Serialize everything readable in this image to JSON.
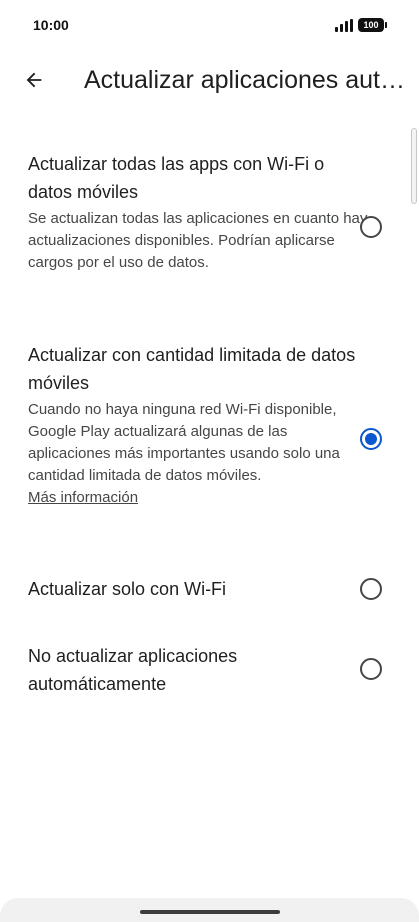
{
  "status_bar": {
    "time": "10:00",
    "battery": "100",
    "icons": [
      "signal-icon",
      "battery-icon"
    ]
  },
  "app_bar": {
    "title": "Actualizar aplicaciones automáticamente",
    "back_icon": "arrow-back-icon"
  },
  "options": [
    {
      "title": "Actualizar todas las apps con Wi-Fi o datos móviles",
      "description": "Se actualizan todas las aplicaciones en cuanto hay actualizaciones disponibles. Podrían aplicarse cargos por el uso de datos.",
      "selected": false
    },
    {
      "title": "Actualizar con cantidad limitada de datos móviles",
      "description": "Cuando no haya ninguna red Wi-Fi disponible, Google Play actualizará algunas de las aplicaciones más importantes usando solo una cantidad limitada de datos móviles.",
      "link": "Más información",
      "selected": true
    },
    {
      "title": "Actualizar solo con Wi-Fi",
      "selected": false
    },
    {
      "title": "No actualizar aplicaciones automáticamente",
      "selected": false
    }
  ],
  "colors": {
    "accent": "#0b57d0",
    "text_primary": "#1f1f1f",
    "text_secondary": "#444746"
  }
}
